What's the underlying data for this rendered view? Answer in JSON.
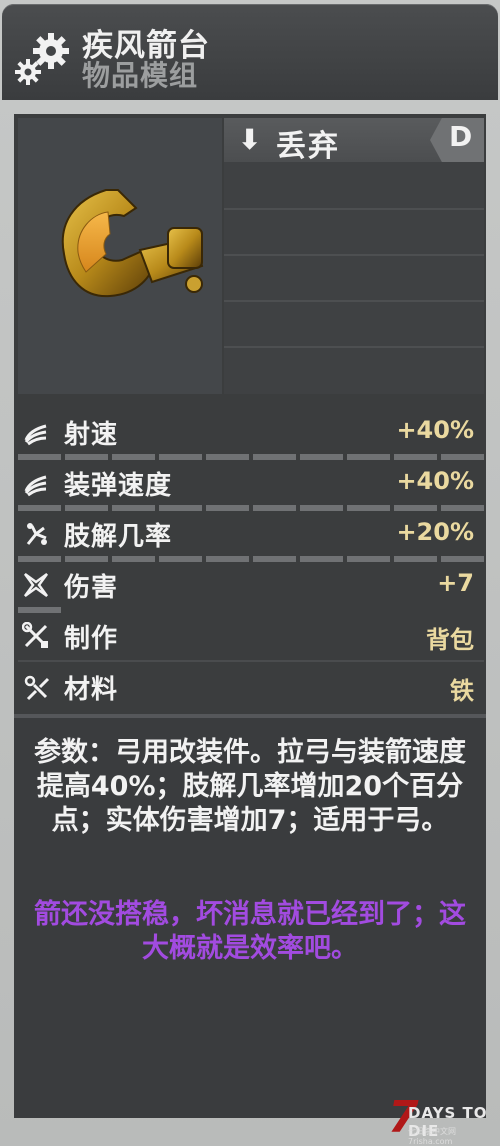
{
  "header": {
    "title": "疾风箭台",
    "subtitle": "物品模组"
  },
  "action": {
    "drop_label": "丢弃",
    "drop_key": "D"
  },
  "stats": [
    {
      "icon": "fire-rate-icon",
      "label": "射速",
      "value": "+40%"
    },
    {
      "icon": "reload-speed-icon",
      "label": "装弹速度",
      "value": "+40%"
    },
    {
      "icon": "dismember-icon",
      "label": "肢解几率",
      "value": "+20%"
    },
    {
      "icon": "damage-icon",
      "label": "伤害",
      "value": "+7"
    },
    {
      "icon": "crafting-tools-icon",
      "label": "制作",
      "value": "背包"
    },
    {
      "icon": "materials-icon",
      "label": "材料",
      "value": "铁"
    }
  ],
  "description": "参数：弓用改装件。拉弓与装箭速度提高40%；肢解几率增加20个百分点；实体伤害增加7；适用于弓。",
  "flavor_text": "箭还没搭稳，坏消息就已经到了；这大概就是效率吧。",
  "logo": {
    "seven": "7",
    "name": "DAYS TO DIE",
    "sub": "七日杀中文网7risha.com"
  },
  "colors": {
    "stat_value": "#ead9a0",
    "flavor": "#a24be0",
    "item_gold": "#c89a1e"
  }
}
